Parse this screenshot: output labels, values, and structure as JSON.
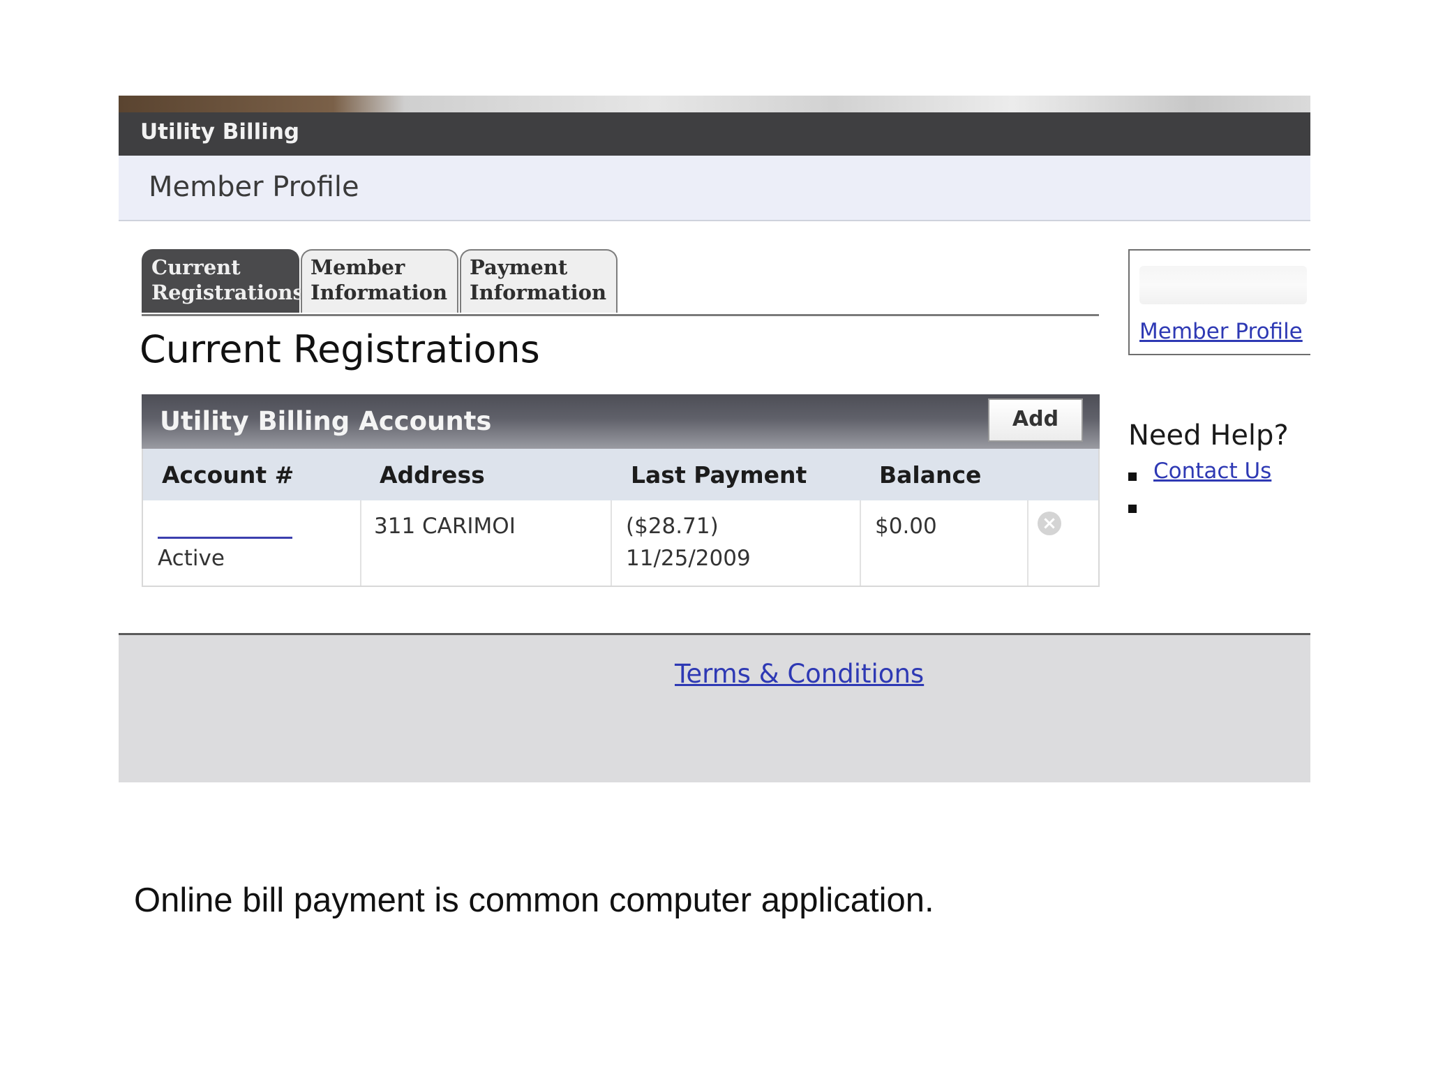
{
  "app": {
    "title": "Utility Billing",
    "page_title": "Member Profile"
  },
  "tabs": [
    {
      "label": "Current\nRegistrations",
      "active": true
    },
    {
      "label": "Member\nInformation",
      "active": false
    },
    {
      "label": "Payment\nInformation",
      "active": false
    }
  ],
  "main": {
    "heading": "Current Registrations",
    "panel": {
      "title": "Utility Billing Accounts",
      "add_label": "Add",
      "columns": [
        "Account #",
        "Address",
        "Last Payment",
        "Balance"
      ],
      "rows": [
        {
          "account_number": "",
          "status": "Active",
          "address": "311 CARIMOI",
          "last_payment_amount": "($28.71)",
          "last_payment_date": "11/25/2009",
          "balance": "$0.00"
        }
      ]
    }
  },
  "sidebar": {
    "profile_link": "Member Profile",
    "help_heading": "Need Help?",
    "help_links": [
      "Contact Us",
      ""
    ]
  },
  "footer": {
    "terms_link": "Terms & Conditions"
  },
  "caption": "Online bill payment is common computer application.",
  "colors": {
    "title_bar": "#3f3f41",
    "profile_bar": "#eceef8",
    "link": "#2e39b4",
    "footer": "#dcdcde"
  }
}
